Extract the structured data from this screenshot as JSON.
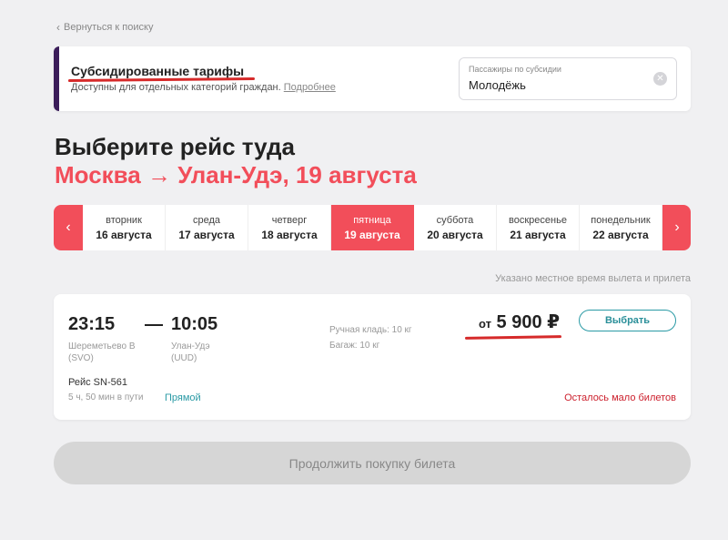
{
  "back_link": "Вернуться к поиску",
  "subsidy": {
    "title": "Субсидированные тарифы",
    "description": "Доступны для отдельных категорий граждан.",
    "more_link": "Подробнее",
    "passenger_field": {
      "label": "Пассажиры по субсидии",
      "value": "Молодёжь"
    }
  },
  "heading": "Выберите рейс туда",
  "route": "Москва → Улан-Удэ, 19 августа",
  "dates": [
    {
      "weekday": "вторник",
      "date": "16 августа"
    },
    {
      "weekday": "среда",
      "date": "17 августа"
    },
    {
      "weekday": "четверг",
      "date": "18 августа"
    },
    {
      "weekday": "пятница",
      "date": "19 августа",
      "active": true
    },
    {
      "weekday": "суббота",
      "date": "20 августа"
    },
    {
      "weekday": "воскресенье",
      "date": "21 августа"
    },
    {
      "weekday": "понедельник",
      "date": "22 августа"
    }
  ],
  "local_time_note": "Указано местное время вылета и прилета",
  "flight": {
    "departure_time": "23:15",
    "arrival_time": "10:05",
    "departure_airport": "Шереметьево B",
    "departure_code": "(SVO)",
    "arrival_airport": "Улан-Удэ",
    "arrival_code": "(UUD)",
    "hand_luggage": "Ручная кладь: 10 кг",
    "baggage": "Багаж: 10 кг",
    "price_prefix": "от",
    "price": "5 900 ₽",
    "select_label": "Выбрать",
    "flight_number": "Рейс SN-561",
    "duration": "5 ч, 50 мин в пути",
    "direct_label": "Прямой",
    "availability": "Осталось мало билетов"
  },
  "continue_label": "Продолжить покупку билета",
  "colors": {
    "accent": "#f24e5a",
    "teal": "#2a9aa5",
    "warning": "#cc1f2c"
  }
}
